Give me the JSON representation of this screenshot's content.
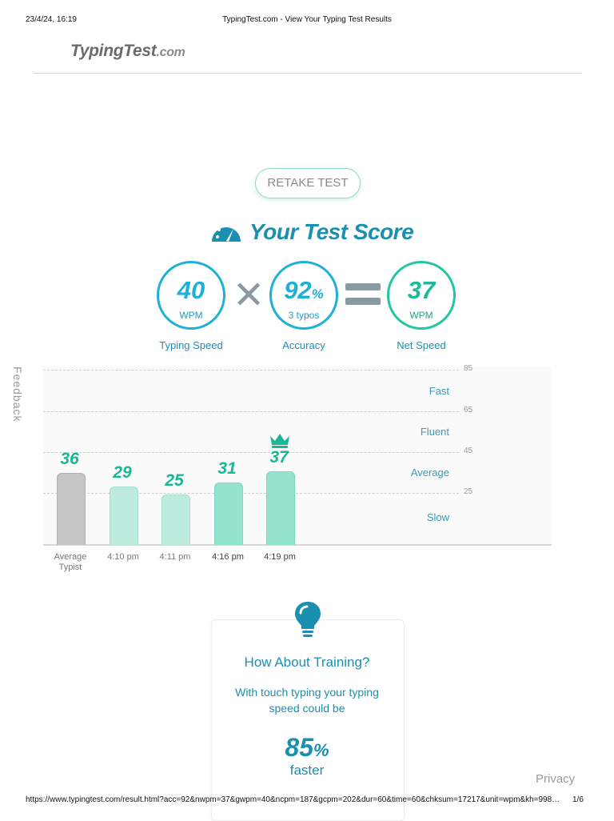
{
  "print": {
    "datetime": "23/4/24, 16:19",
    "title": "TypingTest.com - View Your Typing Test Results",
    "url": "https://www.typingtest.com/result.html?acc=92&nwpm=37&gwpm=40&ncpm=187&gcpm=202&dur=60&time=60&chksum=17217&unit=wpm&kh=998…",
    "page": "1/6"
  },
  "header": {
    "logo_main": "TypingTest",
    "logo_suffix": ".com"
  },
  "retake_label": "RETAKE TEST",
  "score": {
    "title": "Your Test Score",
    "typing_speed": {
      "value": "40",
      "unit": "WPM",
      "label": "Typing Speed"
    },
    "accuracy": {
      "value": "92",
      "unit_symbol": "%",
      "sub": "3 typos",
      "label": "Accuracy"
    },
    "net_speed": {
      "value": "37",
      "unit": "WPM",
      "label": "Net Speed"
    }
  },
  "feedback_label": "Feedback",
  "chart_data": {
    "type": "bar",
    "categories": [
      "Average Typist",
      "4:10 pm",
      "4:11 pm",
      "4:16 pm",
      "4:19 pm"
    ],
    "values": [
      36,
      29,
      25,
      31,
      37
    ],
    "ylim": [
      0,
      85
    ],
    "ticks": [
      "85",
      "65",
      "45",
      "25"
    ],
    "zones": [
      "Fast",
      "Fluent",
      "Average",
      "Slow"
    ],
    "highlight": "4:19 pm",
    "colors": {
      "average": "#c6c6c6",
      "light": "#bdecdf",
      "recent": "#94e3cf",
      "value_text": "#18b894"
    }
  },
  "training": {
    "title": "How About Training?",
    "text": "With touch typing your typing speed could be",
    "percent": "85",
    "percent_symbol": "%",
    "suffix": "faster"
  },
  "privacy_label": "Privacy"
}
